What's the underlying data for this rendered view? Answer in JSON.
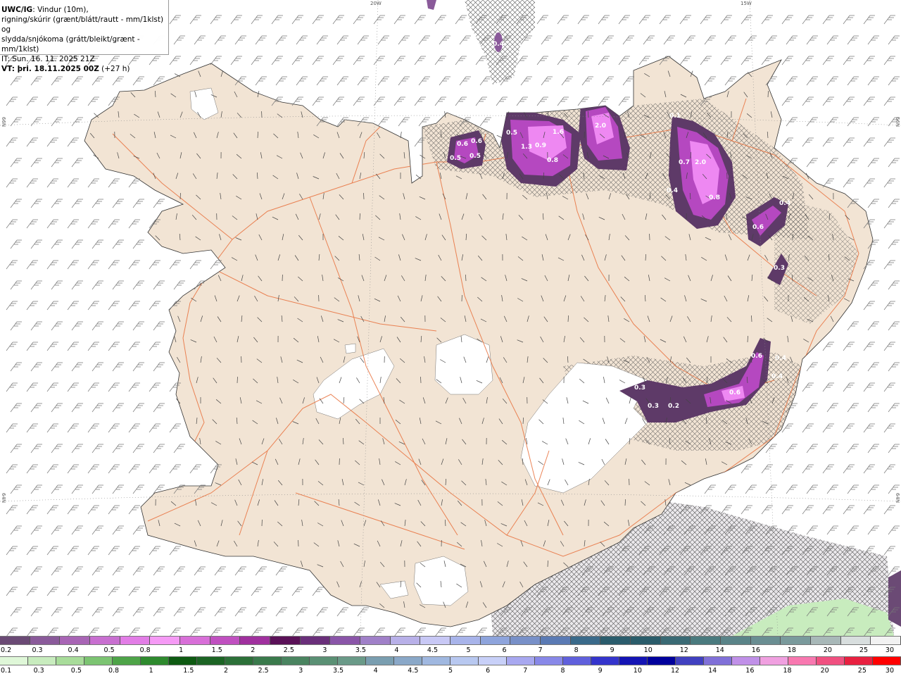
{
  "header": {
    "model": "UWC/IG",
    "title_rest": ": Vindur (10m),",
    "line2": "rigning/skúrir (grænt/blátt/rautt - mm/1klst) og",
    "line3": "slydda/snjókoma (grátt/bleikt/grænt - mm/1klst)",
    "init_time": "IT: Sun. 16. 11. 2025 21Z",
    "valid_prefix": "VT: þri. 18.11.2025 00Z",
    "valid_offset": "(+27 h)"
  },
  "grid_labels": {
    "lon_20w": "20W",
    "lon_15w": "15W",
    "lat_66n_left": "66N",
    "lat_66n_right": "66N",
    "lat_64n_left": "64N",
    "lat_64n_right": "64N"
  },
  "precip_labels": [
    {
      "text": "0.4",
      "region": "nw-offshore"
    },
    {
      "text": "0.6",
      "region": "trollaskagi"
    },
    {
      "text": "0.6",
      "region": "trollaskagi"
    },
    {
      "text": "0.5",
      "region": "trollaskagi"
    },
    {
      "text": "0.5",
      "region": "trollaskagi"
    },
    {
      "text": "0.5",
      "region": "eyjafjordur"
    },
    {
      "text": "1.6",
      "region": "eyjafjordur"
    },
    {
      "text": "1.3",
      "region": "eyjafjordur"
    },
    {
      "text": "0.9",
      "region": "eyjafjordur"
    },
    {
      "text": "0.8",
      "region": "eyjafjordur"
    },
    {
      "text": "2.0",
      "region": "husavik"
    },
    {
      "text": "0.1",
      "region": "northeast"
    },
    {
      "text": "0.7",
      "region": "northeast"
    },
    {
      "text": "2.0",
      "region": "northeast"
    },
    {
      "text": "0.4",
      "region": "northeast"
    },
    {
      "text": "0.8",
      "region": "northeast"
    },
    {
      "text": "0.4",
      "region": "east-coast"
    },
    {
      "text": "0.6",
      "region": "east-coast"
    },
    {
      "text": "0.3",
      "region": "east-coast"
    },
    {
      "text": "0.6",
      "region": "vatnajokull-east"
    },
    {
      "text": "0.4",
      "region": "vatnajokull-east"
    },
    {
      "text": "0.6",
      "region": "vatnajokull-east"
    },
    {
      "text": "0.4",
      "region": "vatnajokull-east"
    },
    {
      "text": "0.3",
      "region": "vatnajokull-north"
    },
    {
      "text": "0.3",
      "region": "vatnajokull-north"
    },
    {
      "text": "0.2",
      "region": "vatnajokull-north"
    }
  ],
  "legend_snow": {
    "colors": [
      "#6b4a75",
      "#8a5a9a",
      "#a865b5",
      "#c86fd0",
      "#e27de6",
      "#f59af5",
      "#d86fd8",
      "#c050c0",
      "#a0309e",
      "#5a1057",
      "#6a2f7a",
      "#8a55a8",
      "#a080c8",
      "#b8b0e8",
      "#c8c8f5",
      "#a8b4ea",
      "#8ea4dc",
      "#7890c8",
      "#5a7ab4",
      "#3a6a8a",
      "#2a5c6c",
      "#2a5c6a",
      "#3a6a74",
      "#4a7a7e",
      "#5a8488",
      "#6a8e92",
      "#7a9a9c",
      "#a8b8b8",
      "#d8dede",
      "#f2f2f2"
    ],
    "labels": [
      "0.2",
      "0.3",
      "0.4",
      "0.5",
      "0.8",
      "1",
      "1.5",
      "2",
      "2.5",
      "3",
      "3.5",
      "4",
      "4.5",
      "5",
      "6",
      "7",
      "8",
      "9",
      "10",
      "12",
      "14",
      "16",
      "18",
      "20",
      "25",
      "30"
    ]
  },
  "legend_rain": {
    "colors": [
      "#dff7d8",
      "#c8ecbe",
      "#a8dc9a",
      "#7cc472",
      "#4ea448",
      "#2e8a2e",
      "#0e5a12",
      "#1c6424",
      "#2c7038",
      "#3a7a4c",
      "#4a8460",
      "#5a9074",
      "#6a9a88",
      "#7a9eb0",
      "#8aa8c8",
      "#a0b8e0",
      "#b8c8f0",
      "#c8d0f8",
      "#a8a8f0",
      "#8888e8",
      "#6060dc",
      "#3434cc",
      "#1414b4",
      "#00009c",
      "#4040c0",
      "#8070d8",
      "#c090e8",
      "#f0a0e0",
      "#f878b0",
      "#f05080",
      "#e82040",
      "#ff0000"
    ],
    "labels": [
      "0.1",
      "0.3",
      "0.5",
      "0.8",
      "1",
      "1.5",
      "2",
      "2.5",
      "3",
      "3.5",
      "4",
      "4.5",
      "5",
      "6",
      "7",
      "8",
      "9",
      "10",
      "12",
      "14",
      "16",
      "18",
      "20",
      "25",
      "30"
    ]
  },
  "colors": {
    "land": "#f2e4d4",
    "roads": "#e8703c",
    "glacier": "#ffffff",
    "snow_dark": "#5e3a68",
    "snow_mid": "#b548c0",
    "snow_light": "#ee88f2"
  }
}
